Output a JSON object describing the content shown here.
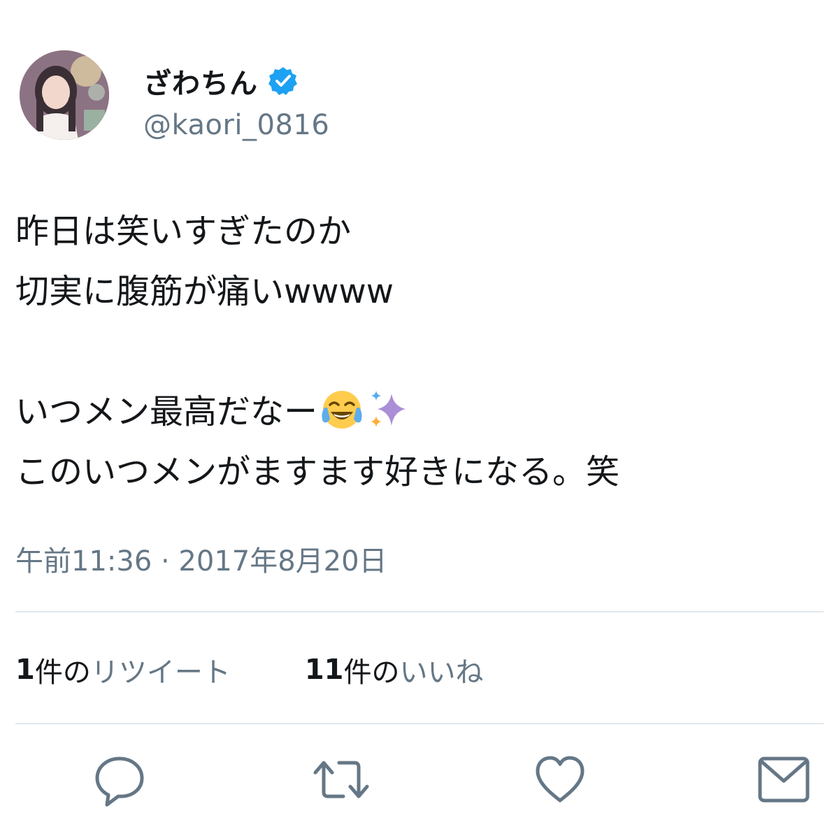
{
  "tweet": {
    "author": {
      "display_name": "ざわちん",
      "handle": "@kaori_0816",
      "verified": true,
      "avatar_icon": "profile-photo"
    },
    "lines": [
      "昨日は笑いすぎたのか",
      "切実に腹筋が痛いwwww",
      "",
      "いつメン最高だなー",
      "このいつメンがますます好きになる。笑"
    ],
    "emojis": [
      "face-with-tears-of-joy-icon",
      "sparkles-icon"
    ],
    "timestamp": "午前11:36 · 2017年8月20日",
    "stats": {
      "retweets_count": "1",
      "retweets_label_dark": "件の",
      "retweets_label": "リツイート",
      "likes_count": "11",
      "likes_label_dark": "件の",
      "likes_label": "いいね"
    },
    "actions": [
      "reply-icon",
      "retweet-icon",
      "like-icon",
      "share-icon"
    ]
  },
  "colors": {
    "text": "#14171a",
    "secondary": "#657786",
    "divider": "#e1e8ed",
    "verified": "#1da1f2"
  }
}
